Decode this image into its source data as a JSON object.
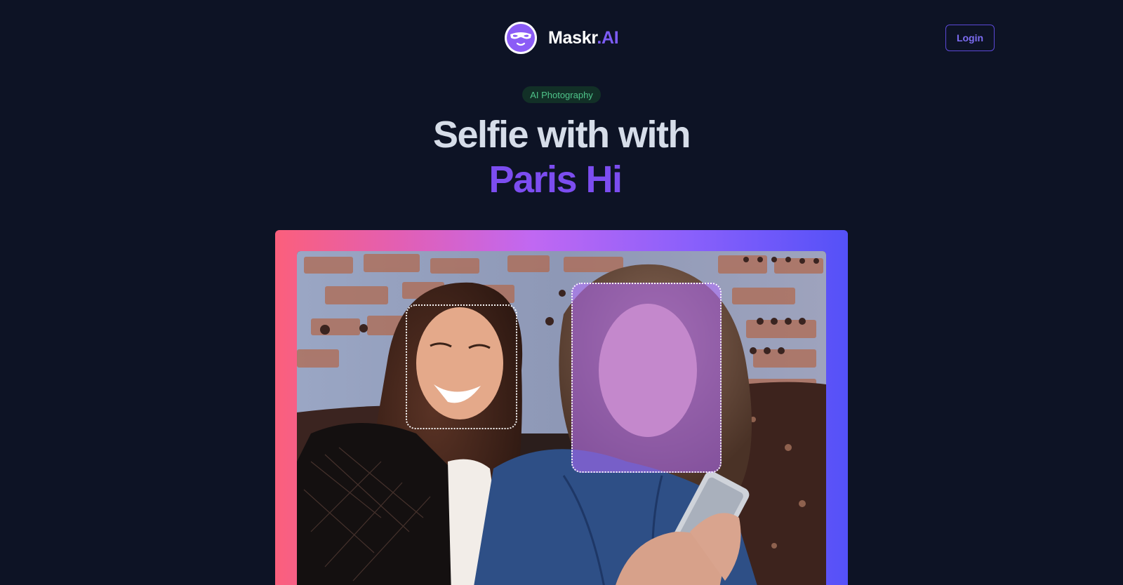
{
  "header": {
    "brand_name": "Maskr",
    "brand_suffix": ".AI",
    "login_label": "Login",
    "logo_icon": "masked-face-logo-icon"
  },
  "hero": {
    "tag": "AI Photography",
    "title_line1": "Selfie with with",
    "title_line2": "Paris Hi"
  },
  "showcase": {
    "image": "two-women-selfie-photo",
    "face_boxes": [
      "left-face-selection",
      "right-face-swapped-selection"
    ]
  },
  "colors": {
    "background": "#0d1325",
    "accent": "#7c4df0",
    "tag_text": "#4fc48a",
    "frame_gradient": [
      "#fb5f7c",
      "#c068f2",
      "#5451f8"
    ]
  }
}
